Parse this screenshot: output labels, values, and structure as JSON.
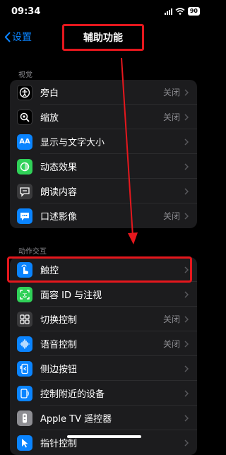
{
  "status": {
    "time": "09:34",
    "battery": "90"
  },
  "nav": {
    "back_label": "设置",
    "title": "辅助功能"
  },
  "sections": [
    {
      "header": "视觉",
      "rows": [
        {
          "label": "旁白",
          "value": "关闭",
          "icon": "voiceover-icon",
          "color": "#000000"
        },
        {
          "label": "缩放",
          "value": "关闭",
          "icon": "zoom-icon",
          "color": "#000000"
        },
        {
          "label": "显示与文字大小",
          "value": "",
          "icon": "text-size-icon",
          "color": "#0a84ff"
        },
        {
          "label": "动态效果",
          "value": "",
          "icon": "motion-icon",
          "color": "#30d158"
        },
        {
          "label": "朗读内容",
          "value": "",
          "icon": "spoken-content-icon",
          "color": "#3a3a3c"
        },
        {
          "label": "口述影像",
          "value": "关闭",
          "icon": "audio-description-icon",
          "color": "#0a84ff"
        }
      ]
    },
    {
      "header": "动作交互",
      "rows": [
        {
          "label": "触控",
          "value": "",
          "icon": "touch-icon",
          "color": "#0a84ff"
        },
        {
          "label": "面容 ID 与注视",
          "value": "",
          "icon": "face-id-icon",
          "color": "#30d158"
        },
        {
          "label": "切换控制",
          "value": "关闭",
          "icon": "switch-control-icon",
          "color": "#3a3a3c"
        },
        {
          "label": "语音控制",
          "value": "关闭",
          "icon": "voice-control-icon",
          "color": "#0a84ff"
        },
        {
          "label": "侧边按钮",
          "value": "",
          "icon": "side-button-icon",
          "color": "#0a84ff"
        },
        {
          "label": "控制附近的设备",
          "value": "",
          "icon": "nearby-devices-icon",
          "color": "#0a84ff"
        },
        {
          "label": "Apple TV 遥控器",
          "value": "",
          "icon": "tv-remote-icon",
          "color": "#8e8e93"
        },
        {
          "label": "指针控制",
          "value": "",
          "icon": "pointer-control-icon",
          "color": "#0a84ff"
        }
      ]
    }
  ],
  "colors": {
    "accent": "#0a84ff",
    "highlight": "#e5171d",
    "background": "#000000",
    "cell": "#1c1c1e"
  }
}
